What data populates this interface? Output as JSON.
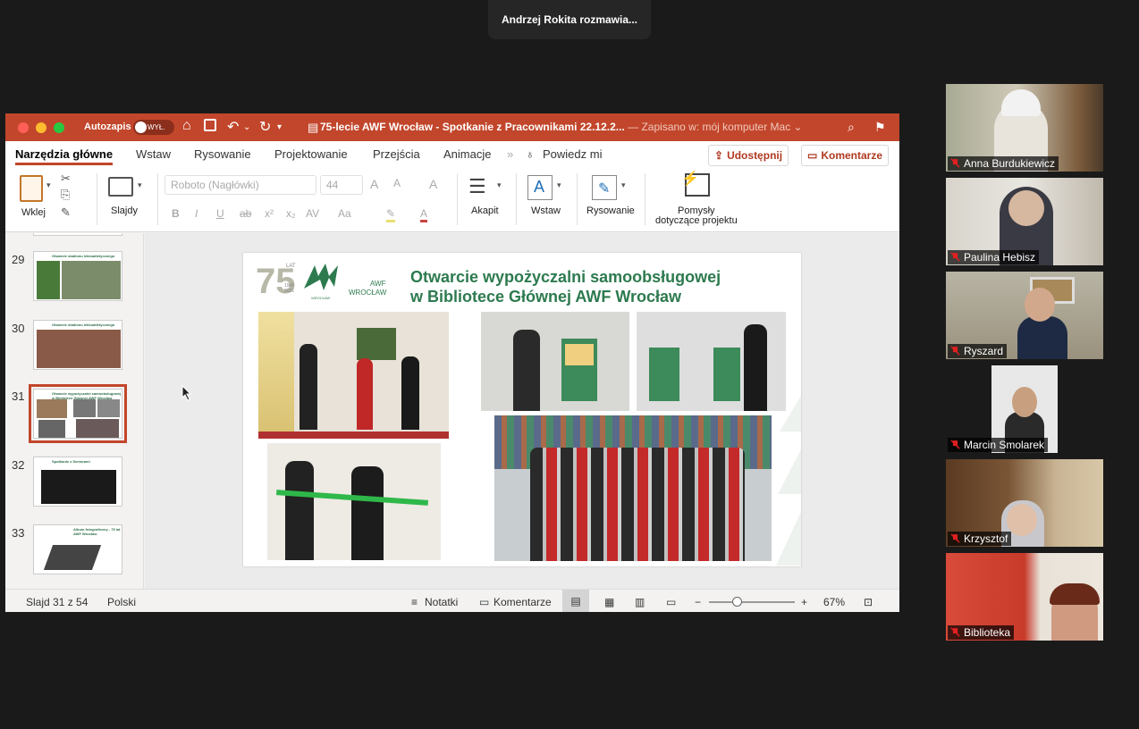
{
  "meeting": {
    "speaking_label": "Andrzej Rokita rozmawia..."
  },
  "window": {
    "autosave_label": "Autozapis",
    "autosave_state": "WYŁ.",
    "doc_title": "75-lecie AWF Wrocław - Spotkanie z Pracownikami 22.12.2...",
    "doc_subtitle": "— Zapisano w: mój komputer Mac"
  },
  "tabs": [
    "Narzędzia główne",
    "Wstaw",
    "Rysowanie",
    "Projektowanie",
    "Przejścia",
    "Animacje"
  ],
  "tell_me": "Powiedz mi",
  "share_label": "Udostępnij",
  "comments_label": "Komentarze",
  "ribbon": {
    "paste": "Wklej",
    "slides": "Slajdy",
    "font": "Roboto (Nagłówki)",
    "size": "44",
    "paragraph": "Akapit",
    "insert": "Wstaw",
    "drawing": "Rysowanie",
    "ideas_line1": "Pomysły",
    "ideas_line2": "dotyczące projektu"
  },
  "thumbnails": [
    {
      "num": "29",
      "title": "Otwarcie stadionu lekkoatletycznego"
    },
    {
      "num": "30",
      "title": "Otwarcie stadionu lekkoatletycznego"
    },
    {
      "num": "31",
      "title": "Otwarcie wypożyczalni samoobsługowej w Bibliotece Głównej AWF Wrocław"
    },
    {
      "num": "32",
      "title": "Spotkanie z Seniorami"
    },
    {
      "num": "33",
      "title": "Album fotograficzny - 75 lat AWF Wrocław"
    }
  ],
  "slide": {
    "logo_number": "75",
    "logo_lat": "LAT",
    "logo_years": "1946 2021",
    "logo_awf": "AWF",
    "logo_city": "WROCŁAW",
    "logo_small": "WROCŁAW",
    "title_line1": "Otwarcie wypożyczalni samoobsługowej",
    "title_line2": "w Bibliotece Głównej AWF Wrocław"
  },
  "status": {
    "slide_pos": "Slajd 31 z 54",
    "language": "Polski",
    "notes": "Notatki",
    "comments": "Komentarze",
    "zoom": "67%"
  },
  "participants": [
    {
      "name": "Anna Burdukiewicz"
    },
    {
      "name": "Paulina Hebisz"
    },
    {
      "name": "Ryszard"
    },
    {
      "name": "Marcin Smolarek"
    },
    {
      "name": "Krzysztof"
    },
    {
      "name": "Biblioteka"
    }
  ],
  "colors": {
    "accent": "#c2462b",
    "slide_green": "#2d7a4f"
  }
}
